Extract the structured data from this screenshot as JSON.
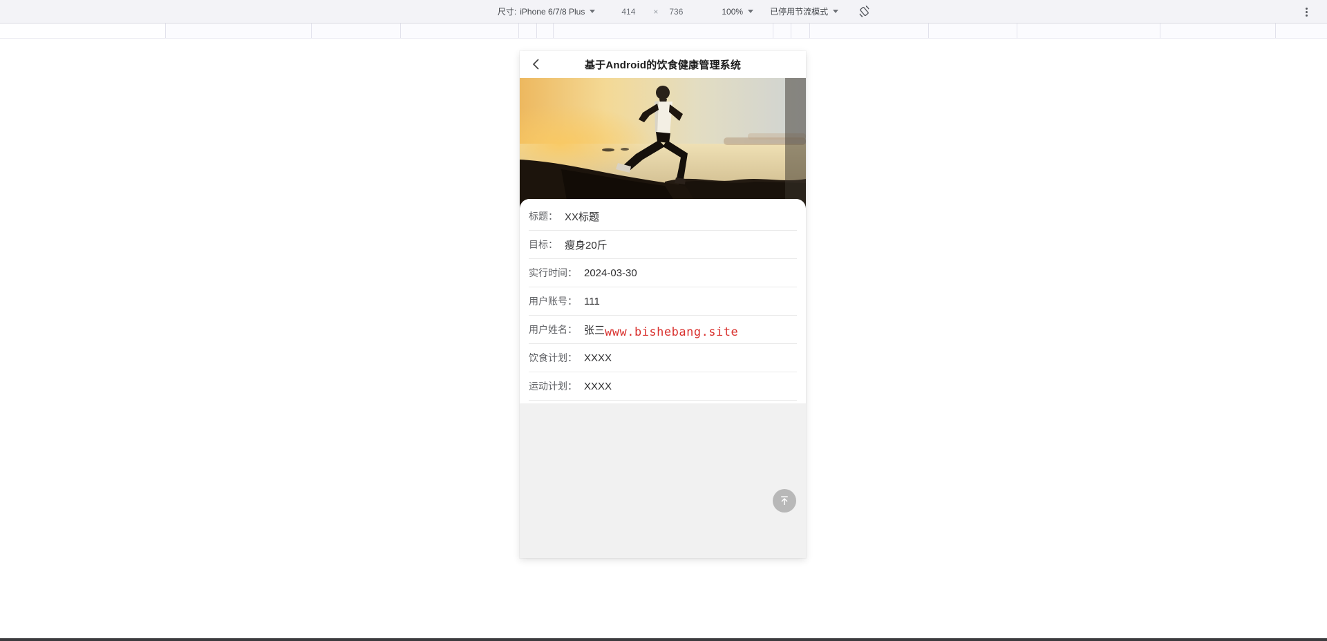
{
  "toolbar": {
    "dimensions_label": "尺寸:",
    "device_name": "iPhone 6/7/8 Plus",
    "width_value": "414",
    "times_symbol": "×",
    "height_value": "736",
    "zoom_value": "100%",
    "throttling_value": "已停用节流模式"
  },
  "icons": {
    "rotate": "rotate-device-icon",
    "more": "kebab-menu-icon",
    "back": "chevron-left-icon",
    "fab": "back-to-top-icon"
  },
  "app": {
    "title": "基于Android的饮食健康管理系统",
    "hero_image": "silhouette runner at sunset on rocky seashore",
    "form": {
      "rows": [
        {
          "label": "标题：",
          "value": "XX标题"
        },
        {
          "label": "目标：",
          "value": "瘦身20斤"
        },
        {
          "label": "实行时间：",
          "value": "2024-03-30"
        },
        {
          "label": "用户账号：",
          "value": "111"
        },
        {
          "label": "用户姓名：",
          "value": "张三",
          "watermark": "www.bishebang.site"
        },
        {
          "label": "饮食计划：",
          "value": "XXXX"
        },
        {
          "label": "运动计划：",
          "value": "XXXX"
        }
      ]
    }
  },
  "colors": {
    "toolbar_bg": "#f3f3f7",
    "watermark_red": "#d9312e",
    "footer_gray": "#f1f1f1",
    "fab_gray": "#b4b4b4",
    "taskbar_dark": "#3b3b3e"
  }
}
